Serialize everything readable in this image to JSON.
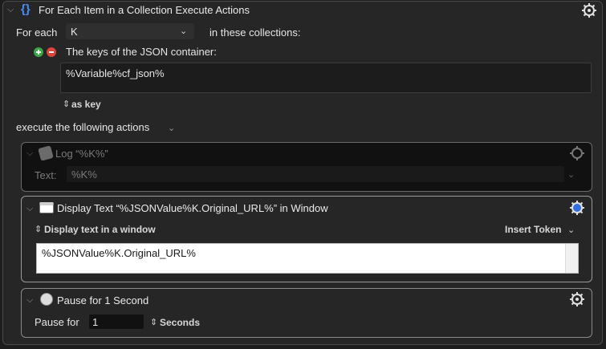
{
  "foreach": {
    "title": "For Each Item in a Collection Execute Actions",
    "for_each_label": "For each",
    "variable": "K",
    "in_collections_label": "in these collections:",
    "collection_label": "The keys of the JSON container:",
    "collection_value": "%Variable%cf_json%",
    "as_key_label": "as key",
    "execute_label": "execute the following actions"
  },
  "actions": {
    "log": {
      "title": "Log “%K%”",
      "text_label": "Text:",
      "text_value": "%K%"
    },
    "display": {
      "title": "Display Text “%JSONValue%K.Original_URL%” in Window",
      "mode_label": "Display text in a window",
      "insert_token_label": "Insert Token",
      "text_value": "%JSONValue%K.Original_URL%"
    },
    "pause": {
      "title": "Pause for 1 Second",
      "pause_label": "Pause for",
      "value": "1",
      "unit": "Seconds"
    }
  },
  "colors": {
    "accent": "#4a8cff",
    "add": "#39a845",
    "remove": "#d9453b"
  }
}
